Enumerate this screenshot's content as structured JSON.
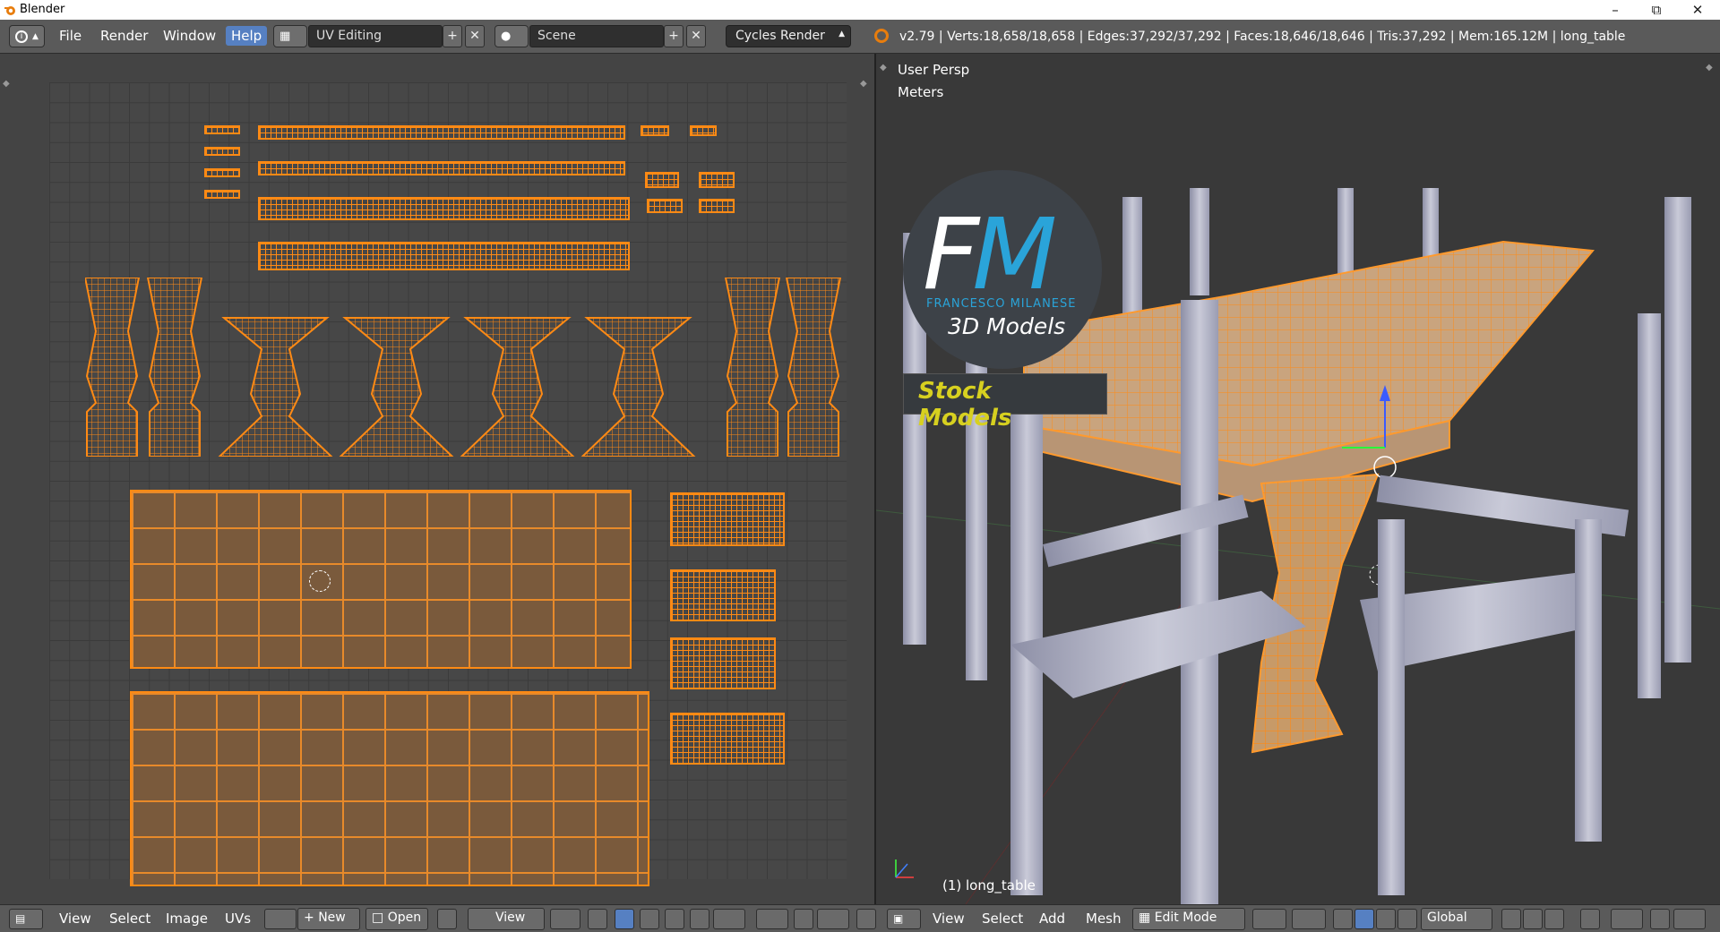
{
  "window": {
    "title": "Blender"
  },
  "menu": {
    "info_icon": "info-icon",
    "items": [
      "File",
      "Render",
      "Window",
      "Help"
    ],
    "active": "Help"
  },
  "screen_layout": {
    "value": "UV Editing"
  },
  "scene": {
    "value": "Scene"
  },
  "engine": {
    "value": "Cycles Render"
  },
  "stats": {
    "text": "v2.79 | Verts:18,658/18,658 | Edges:37,292/37,292 | Faces:18,646/18,646 | Tris:37,292 | Mem:165.12M | long_table"
  },
  "viewport": {
    "perspective": "User Persp",
    "units": "Meters",
    "object_label": "(1) long_table",
    "watermark": {
      "letters_f": "F",
      "letters_m": "M",
      "name": "FRANCESCO MILANESE",
      "sub": "3D Models",
      "banner": "Stock Models"
    }
  },
  "uv_footer": {
    "items": [
      "View",
      "Select",
      "Image",
      "UVs"
    ],
    "new_label": "New",
    "open_label": "Open",
    "view_label": "View"
  },
  "view3d_footer": {
    "items": [
      "View",
      "Select",
      "Add",
      "Mesh"
    ],
    "mode": "Edit Mode",
    "orientation": "Global"
  },
  "colors": {
    "uv_wire": "#ff8a14",
    "selected_mesh": "#ff9a2e",
    "header": "#5a5a5a",
    "accent": "#5680c2"
  }
}
